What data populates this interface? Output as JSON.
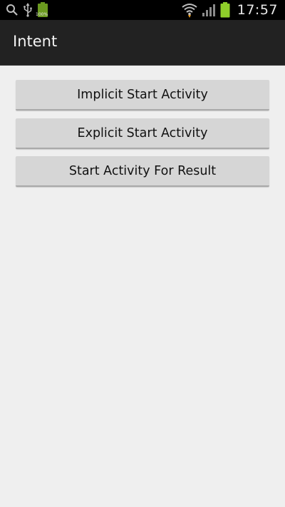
{
  "status_bar": {
    "time": "17:57",
    "battery_small_label": "100%",
    "icons": [
      "search-icon",
      "usb-icon",
      "battery-full-icon",
      "wifi-icon",
      "signal-icon",
      "battery-icon"
    ]
  },
  "action_bar": {
    "title": "Intent"
  },
  "buttons": {
    "implicit": "Implicit Start Activity",
    "explicit": "Explicit Start Activity",
    "for_result": "Start Activity For Result"
  },
  "colors": {
    "status_bar": "#000000",
    "action_bar": "#222222",
    "background": "#efefef",
    "button": "#d6d6d6",
    "battery_green": "#8fcf2a"
  }
}
